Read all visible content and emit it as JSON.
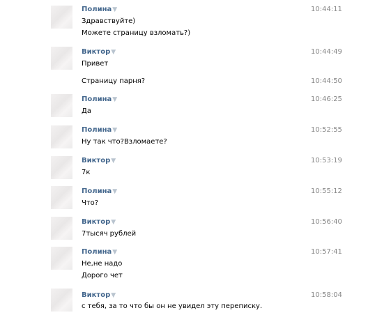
{
  "messages": [
    {
      "author": "Полина",
      "time": "10:44:11",
      "lines": [
        "Здравствуйте)",
        "Можете страницу взломать?)"
      ]
    },
    {
      "author": "Виктор",
      "time": "10:44:49",
      "lines": [
        "Привет"
      ]
    },
    {
      "author": "",
      "time": "10:44:50",
      "lines": [
        "Страницу парня?"
      ]
    },
    {
      "author": "Полина",
      "time": "10:46:25",
      "lines": [
        "Да"
      ]
    },
    {
      "author": "Полина",
      "time": "10:52:55",
      "lines": [
        "Ну так что?Взломаете?"
      ]
    },
    {
      "author": "Виктор",
      "time": "10:53:19",
      "lines": [
        "7к"
      ]
    },
    {
      "author": "Полина",
      "time": "10:55:12",
      "lines": [
        "Что?"
      ]
    },
    {
      "author": "Виктор",
      "time": "10:56:40",
      "lines": [
        "7тысяч рублей"
      ]
    },
    {
      "author": "Полина",
      "time": "10:57:41",
      "lines": [
        "Не,не надо",
        "Дорого чет"
      ]
    },
    {
      "author": "Виктор",
      "time": "10:58:04",
      "lines": [
        "с тебя, за то что бы он не увидел эту переписку."
      ]
    }
  ],
  "icons": {
    "author_menu": "triangle-down-icon"
  }
}
